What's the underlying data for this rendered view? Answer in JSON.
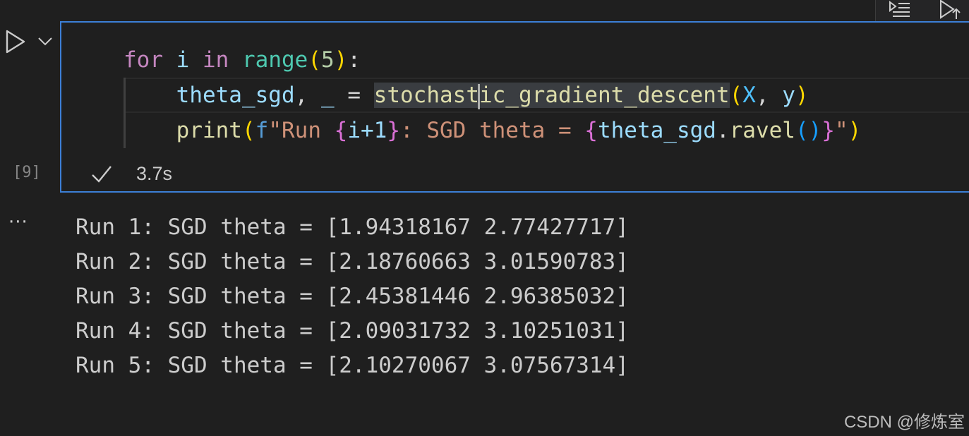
{
  "toolbar": {
    "outline_icon": "list-outline-icon",
    "run_above_icon": "run-above-icon"
  },
  "cell": {
    "execution_count": "[9]",
    "execution_time": "3.7s",
    "status_icon": "check-icon",
    "run_icon": "play-icon",
    "run_menu_icon": "chevron-down-icon",
    "code": {
      "line1": {
        "kw_for": "for",
        "var_i": "i",
        "kw_in": "in",
        "fn_range": "range",
        "paren_open": "(",
        "num_5": "5",
        "paren_close": ")",
        "colon": ":"
      },
      "line2": {
        "var_theta": "theta_sgd",
        "comma": ",",
        "underscore": "_",
        "eq": "=",
        "fn_sgd_a": "stochast",
        "fn_sgd_b": "ic_gradient_descent",
        "paren_open": "(",
        "arg_x": "X",
        "arg_sep": ",",
        "arg_y": "y",
        "paren_close": ")"
      },
      "line3": {
        "fn_print": "print",
        "paren_open": "(",
        "f_prefix": "f",
        "str_a": "\"Run ",
        "brace1_open": "{",
        "expr1": "i+1",
        "brace1_close": "}",
        "str_b": ": SGD theta = ",
        "brace2_open": "{",
        "expr2_var": "theta_sgd",
        "expr2_dot": ".",
        "expr2_fn": "ravel",
        "expr2_parens_open": "(",
        "expr2_parens_close": ")",
        "brace2_close": "}",
        "str_c": "\"",
        "paren_close": ")"
      }
    }
  },
  "output": {
    "more_label": "···",
    "lines": [
      "Run 1: SGD theta = [1.94318167 2.77427717]",
      "Run 2: SGD theta = [2.18760663 3.01590783]",
      "Run 3: SGD theta = [2.45381446 2.96385032]",
      "Run 4: SGD theta = [2.09031732 3.10251031]",
      "Run 5: SGD theta = [2.10270067 3.07567314]"
    ]
  },
  "watermark": "CSDN @修炼室"
}
